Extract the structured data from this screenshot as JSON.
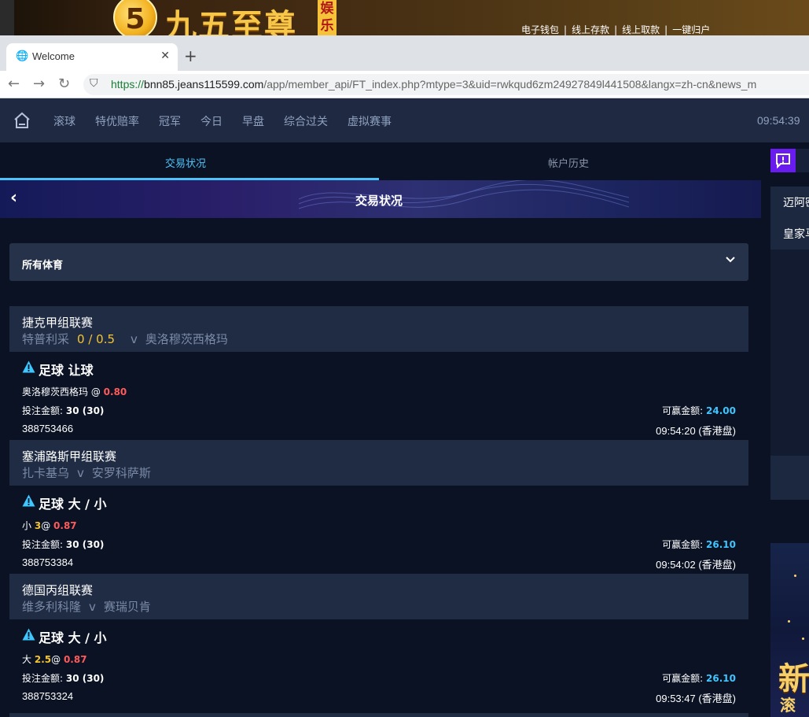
{
  "banner": {
    "logo_numeral": "5",
    "logo_text": "九五至尊",
    "logo_tag": "娱乐",
    "links": [
      "电子钱包",
      "线上存款",
      "线上取款",
      "一键归户"
    ]
  },
  "browser": {
    "tab_title": "Welcome",
    "url_scheme": "https://",
    "url_host": "bnn85.jeans115599.com",
    "url_path": "/app/member_api/FT_index.php?mtype=3&uid=rwkqud6zm24927849l441508&langx=zh-cn&news_m"
  },
  "nav": {
    "items": [
      "滚球",
      "特优赔率",
      "冠军",
      "今日",
      "早盘",
      "综合过关",
      "虚拟赛事"
    ],
    "clock": "09:54:39"
  },
  "subtabs": {
    "active": "交易状况",
    "inactive": "帐户历史"
  },
  "header": {
    "title": "交易状况"
  },
  "filter": {
    "label": "所有体育"
  },
  "bets": [
    {
      "league": "捷克甲组联赛",
      "home": "特普利采",
      "handicap": "0 / 0.5",
      "vs": "v",
      "away": "奥洛穆茨西格玛",
      "bet_type": "足球 让球",
      "pick_text": "奥洛穆茨西格玛",
      "pick_line": "",
      "at": "@",
      "odds": "0.80",
      "stake_label": "投注金额:",
      "stake_value": "30 (30)",
      "win_label": "可赢金额:",
      "win_value": "24.00",
      "ticket": "388753466",
      "time": "09:54:20 (香港盘)"
    },
    {
      "league": "塞浦路斯甲组联赛",
      "home": "扎卡基乌",
      "handicap": "",
      "vs": "v",
      "away": "安罗科萨斯",
      "bet_type": "足球 大 / 小",
      "pick_text": "小",
      "pick_line": "3",
      "at": "@",
      "odds": "0.87",
      "stake_label": "投注金额:",
      "stake_value": "30 (30)",
      "win_label": "可赢金额:",
      "win_value": "26.10",
      "ticket": "388753384",
      "time": "09:54:02 (香港盘)"
    },
    {
      "league": "德国丙组联赛",
      "home": "维多利科隆",
      "handicap": "",
      "vs": "v",
      "away": "赛瑞贝肯",
      "bet_type": "足球 大 / 小",
      "pick_text": "大",
      "pick_line": "2.5",
      "at": "@",
      "odds": "0.87",
      "stake_label": "投注金额:",
      "stake_value": "30 (30)",
      "win_label": "可赢金额:",
      "win_value": "26.10",
      "ticket": "388753324",
      "time": "09:53:47 (香港盘)"
    }
  ],
  "right_panel": {
    "items": [
      "迈阿密",
      "皇家马"
    ],
    "ad_text": "新",
    "ad_text2": "滚"
  },
  "colors": {
    "accent": "#4fc3f7",
    "odds_red": "#ff5a5a",
    "handicap_yellow": "#f4c430",
    "win_blue": "#3ec6ff",
    "chat_purple": "#6a1cf0"
  },
  "icons": {
    "home": "home-icon",
    "back": "chevron-left-icon",
    "dropdown": "chevron-down-icon",
    "warning": "warning-icon",
    "chat": "chat-alert-icon"
  }
}
